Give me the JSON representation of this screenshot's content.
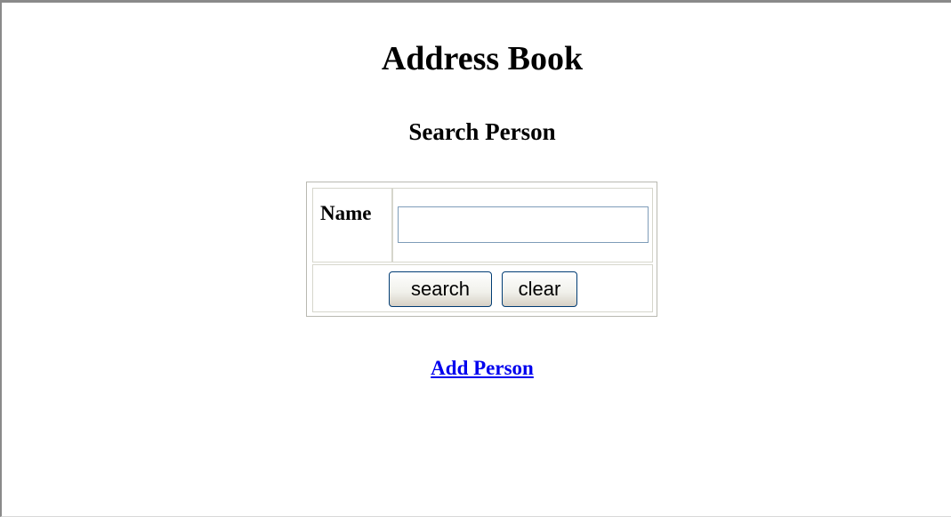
{
  "page": {
    "title": "Address Book",
    "section_title": "Search Person"
  },
  "search_form": {
    "name_label": "Name",
    "name_value": "",
    "search_button": "search",
    "clear_button": "clear"
  },
  "links": {
    "add_person": "Add Person"
  },
  "colors": {
    "link": "#0000ee",
    "input_border": "#7f9db9",
    "button_border": "#003c74"
  }
}
